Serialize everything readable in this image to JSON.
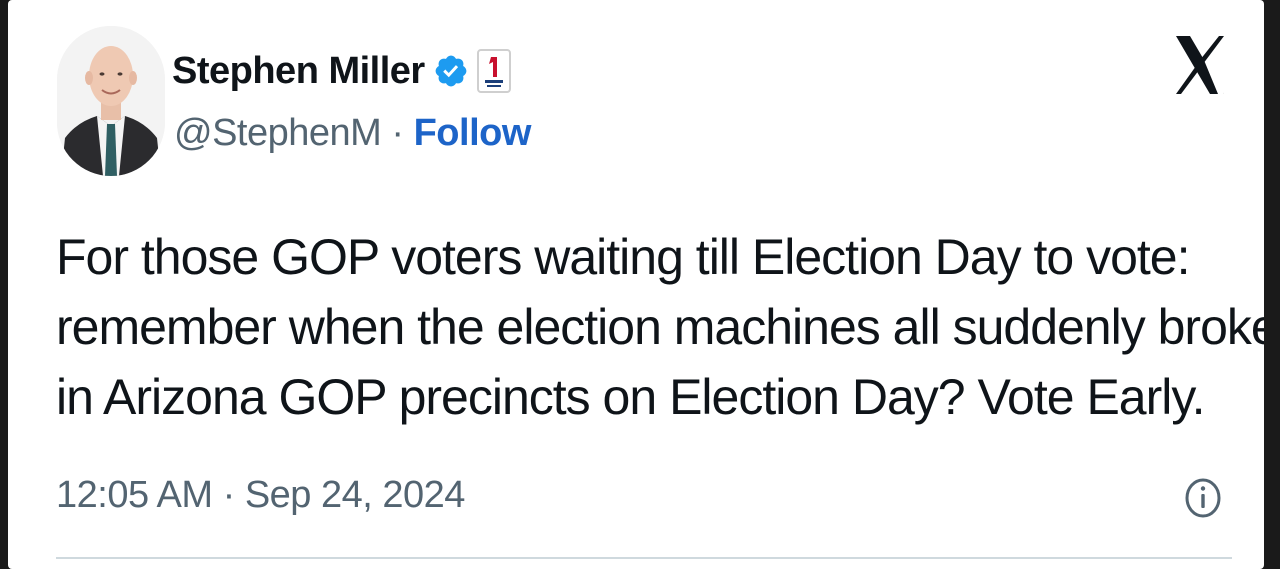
{
  "author": {
    "name": "Stephen Miller",
    "handle": "@StephenM",
    "separator": " · ",
    "follow_label": "Follow",
    "verified": true,
    "avatar_icon": "profile-photo",
    "affiliate_badge_icon": "affiliate-badge"
  },
  "platform_logo": "X",
  "tweet": {
    "lines": [
      "For those GOP voters waiting till Election Day to vote:",
      "remember when the election machines all suddenly broke",
      "in Arizona GOP precincts on Election Day? Vote Early."
    ]
  },
  "meta": {
    "timestamp": "12:05 AM · Sep 24, 2024",
    "info_icon": "info-icon"
  },
  "colors": {
    "follow": "#1d64c8",
    "verified": "#1d9bf0",
    "text": "#0f1419",
    "secondary": "#536471"
  }
}
